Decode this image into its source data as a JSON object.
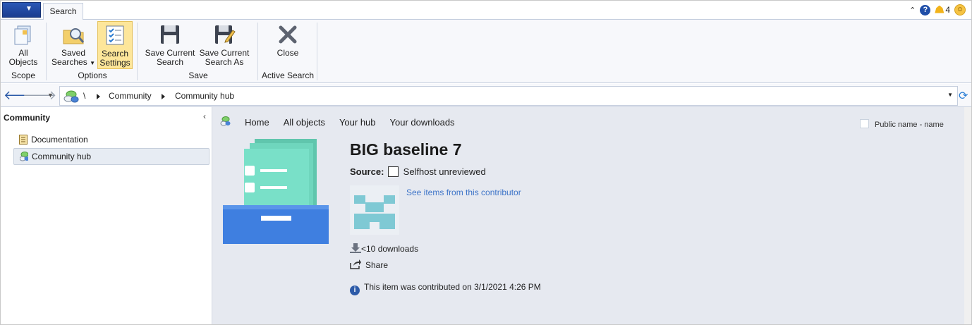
{
  "ribbon": {
    "tab": "Search",
    "notifications_count": "4",
    "buttons": {
      "all_objects": [
        "All",
        "Objects"
      ],
      "saved_searches": [
        "Saved",
        "Searches"
      ],
      "search_settings": [
        "Search",
        "Settings"
      ],
      "save_current": [
        "Save Current",
        "Search"
      ],
      "save_current_as": [
        "Save Current",
        "Search As"
      ],
      "close": "Close"
    },
    "groups": {
      "scope": "Scope",
      "options": "Options",
      "save": "Save",
      "active_search": "Active Search"
    }
  },
  "address": {
    "root": "\\",
    "crumbs": [
      "Community",
      "Community hub"
    ]
  },
  "left_pane": {
    "title": "Community",
    "items": [
      {
        "label": "Documentation",
        "selected": false
      },
      {
        "label": "Community hub",
        "selected": true
      }
    ]
  },
  "content": {
    "nav": [
      "Home",
      "All objects",
      "Your hub",
      "Your downloads"
    ],
    "public_name": "Public name - name",
    "title": "BIG baseline 7",
    "source_label": "Source:",
    "source_value": "Selfhost unreviewed",
    "contributor_link": "See items from this contributor",
    "downloads": "<10 downloads",
    "share": "Share",
    "info": "This item was contributed on 3/1/2021 4:26 PM"
  },
  "colors": {
    "accent_blue": "#1f4ea8",
    "link": "#3d74c8",
    "content_bg": "#e6e9f0",
    "selected_button": "#fde69a",
    "item_green": "#5fcfb3",
    "item_blue": "#3f7fe0"
  }
}
